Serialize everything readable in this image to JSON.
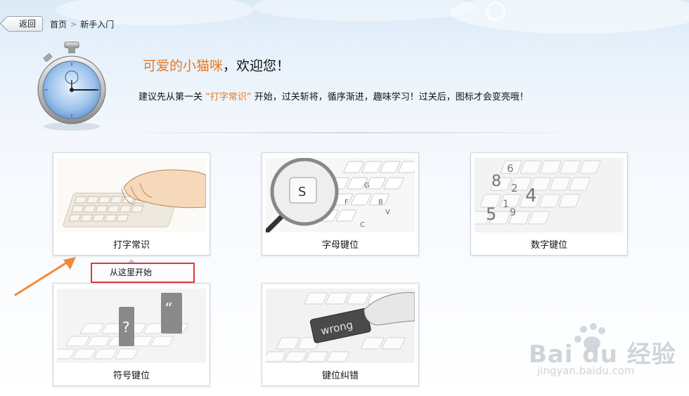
{
  "header": {
    "back_label": "返回",
    "breadcrumb": {
      "home": "首页",
      "separator": ">",
      "current": "新手入门"
    }
  },
  "welcome": {
    "username": "可爱的小猫咪",
    "greeting": "，欢迎您！",
    "tip_before": "建议先从第一关 ",
    "tip_highlight": "“打字常识”",
    "tip_after": " 开始，过关斩将，循序渐进，趣味学习！过关后，图标才会变亮哦！"
  },
  "cards": [
    {
      "label": "打字常识",
      "icon": "typing-hands-icon"
    },
    {
      "label": "字母键位",
      "icon": "magnifier-letter-key-icon"
    },
    {
      "label": "数字键位",
      "icon": "number-keys-icon"
    },
    {
      "label": "符号键位",
      "icon": "symbol-keys-icon"
    },
    {
      "label": "键位纠错",
      "icon": "wrong-key-icon"
    }
  ],
  "hint": {
    "text": "从这里开始"
  },
  "watermark": {
    "brand": "Bai du 经验",
    "url": "jingyan.baidu.com"
  },
  "colors": {
    "accent": "#e8771e",
    "hint_border": "#e03a3a",
    "arrow": "#f08a3c"
  }
}
